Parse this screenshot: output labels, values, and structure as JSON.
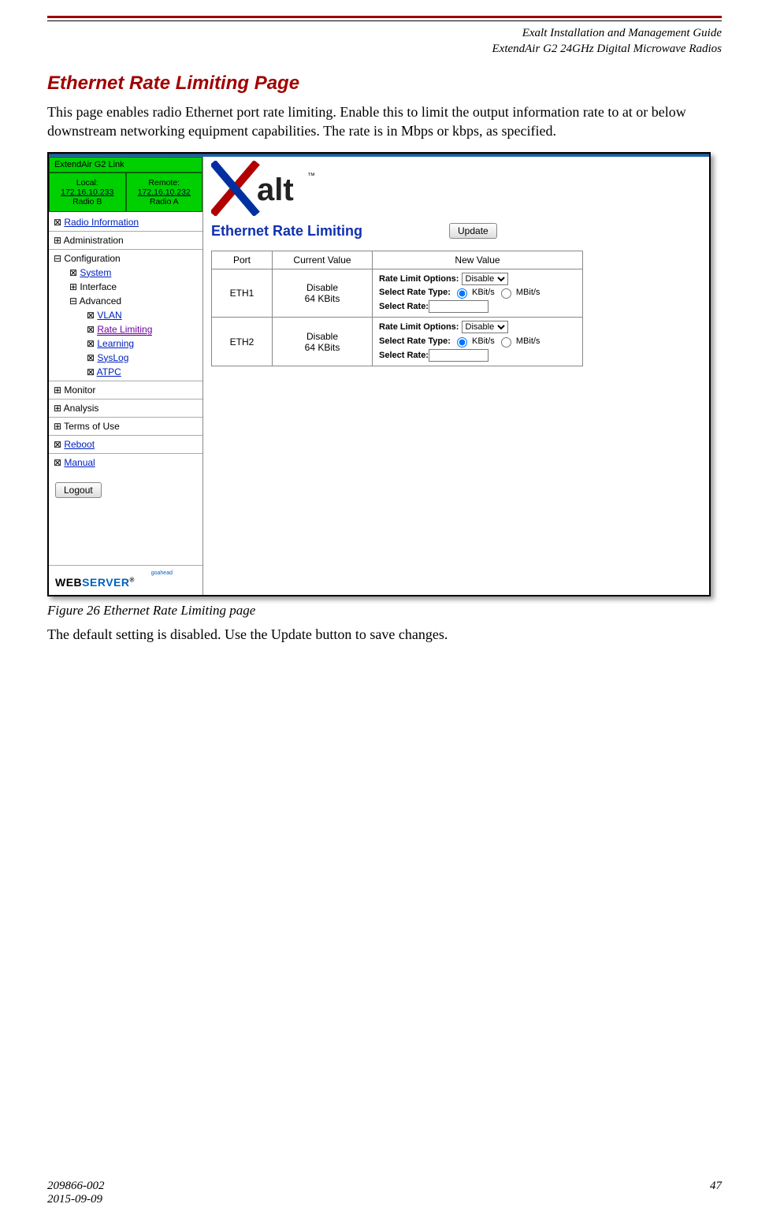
{
  "header": {
    "line1": "Exalt Installation and Management Guide",
    "line2": "ExtendAir G2 24GHz Digital Microwave Radios"
  },
  "section_title": "Ethernet Rate Limiting Page",
  "intro": "This page enables radio Ethernet port rate limiting. Enable this to limit the output information rate to at or below downstream networking equipment capabilities. The rate is in Mbps or kbps, as specified.",
  "figure_caption": "Figure 26   Ethernet Rate Limiting page",
  "after_figure": "The default setting is disabled. Use the Update button to save changes.",
  "footer": {
    "doc_num": "209866-002",
    "date": "2015-09-09",
    "page": "47"
  },
  "ui": {
    "link_label": "ExtendAir G2 Link",
    "local": {
      "label": "Local:",
      "ip": "172.16.10.233",
      "name": "Radio B"
    },
    "remote": {
      "label": "Remote:",
      "ip": "172.16.10.232",
      "name": "Radio A"
    },
    "nav": {
      "radio_info": "Radio Information",
      "administration": "Administration",
      "configuration": "Configuration",
      "system": "System",
      "interface": "Interface",
      "advanced": "Advanced",
      "vlan": "VLAN",
      "rate_limiting": "Rate Limiting",
      "learning": "Learning",
      "syslog": "SysLog",
      "atpc": "ATPC",
      "monitor": "Monitor",
      "analysis": "Analysis",
      "terms": "Terms of Use",
      "reboot": "Reboot",
      "manual": "Manual"
    },
    "logout": "Logout",
    "webserver_small": "goahead",
    "webserver_web": "WEB",
    "webserver_server": "SERVER",
    "page_title": "Ethernet Rate Limiting",
    "update": "Update",
    "table": {
      "hdr_port": "Port",
      "hdr_current": "Current Value",
      "hdr_new": "New Value",
      "rows": [
        {
          "port": "ETH1",
          "current1": "Disable",
          "current2": "64 KBits"
        },
        {
          "port": "ETH2",
          "current1": "Disable",
          "current2": "64 KBits"
        }
      ],
      "opt_label": "Rate Limit Options:",
      "opt_select": "Disable",
      "type_label": "Select Rate Type:",
      "kbit": "KBit/s",
      "mbit": "MBit/s",
      "rate_label": "Select Rate:"
    },
    "logo_text": "alt",
    "logo_tm": "™"
  }
}
